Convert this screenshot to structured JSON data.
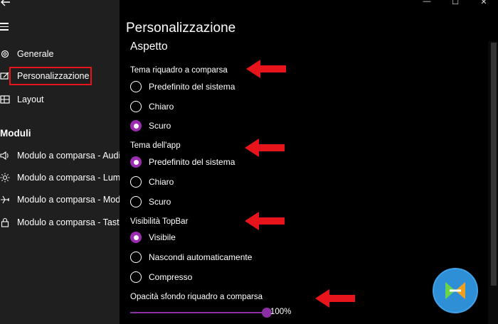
{
  "sidebar": {
    "nav": [
      {
        "label": "Generale",
        "icon": "gear-icon"
      },
      {
        "label": "Personalizzazione",
        "icon": "personalize-icon",
        "selected": true
      },
      {
        "label": "Layout",
        "icon": "layout-icon"
      }
    ],
    "modules_title": "Moduli",
    "modules": [
      {
        "label": "Modulo a comparsa - Audi",
        "icon": "audio-icon"
      },
      {
        "label": "Modulo a comparsa - Lum",
        "icon": "brightness-icon"
      },
      {
        "label": "Modulo a comparsa - Mod",
        "icon": "airplane-icon"
      },
      {
        "label": "Modulo a comparsa - Tasti",
        "icon": "lock-icon"
      }
    ]
  },
  "main": {
    "title": "Personalizzazione",
    "section": "Aspetto",
    "groups": [
      {
        "label": "Tema riquadro a comparsa",
        "options": [
          "Predefinito del sistema",
          "Chiaro",
          "Scuro"
        ],
        "selected_index": 2
      },
      {
        "label": "Tema dell'app",
        "options": [
          "Predefinito del sistema",
          "Chiaro",
          "Scuro"
        ],
        "selected_index": 0
      },
      {
        "label": "Visibilità TopBar",
        "options": [
          "Visibile",
          "Nascondi automaticamente",
          "Compresso"
        ],
        "selected_index": 0
      }
    ],
    "opacity": {
      "label": "Opacità sfondo riquadro a comparsa",
      "value_text": "100%",
      "value": 100
    }
  },
  "colors": {
    "accent": "#9b2bb0",
    "highlight_box": "#e8141c",
    "arrow": "#e8141c",
    "sidebar_bg": "#1f1f1f"
  }
}
